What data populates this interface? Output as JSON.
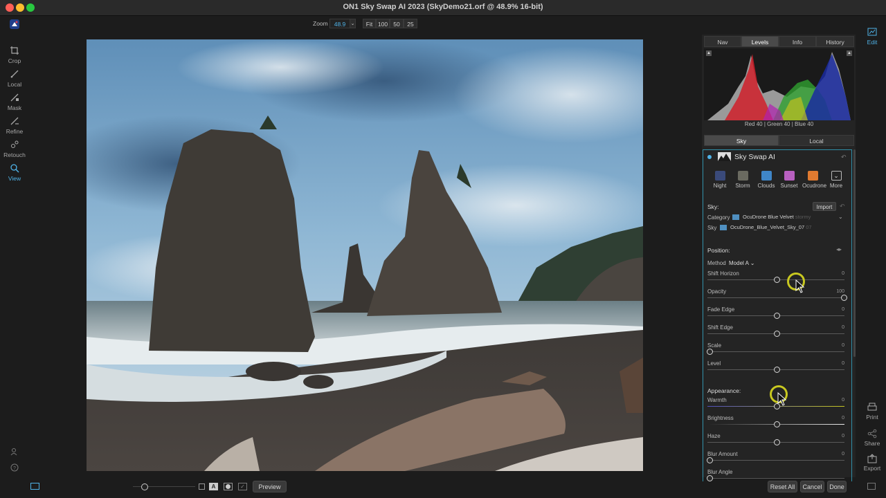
{
  "window": {
    "title": "ON1 Sky Swap AI 2023 (SkyDemo21.orf @ 48.9% 16-bit)"
  },
  "left_tools": [
    {
      "label": "Crop",
      "icon": "crop-icon"
    },
    {
      "label": "Local",
      "icon": "brush-icon"
    },
    {
      "label": "Mask",
      "icon": "mask-brush-icon"
    },
    {
      "label": "Refine",
      "icon": "refine-brush-icon"
    },
    {
      "label": "Retouch",
      "icon": "retouch-icon"
    },
    {
      "label": "View",
      "icon": "view-zoom-icon"
    }
  ],
  "zoom_bar": {
    "label": "Zoom",
    "value": "48.9",
    "presets": [
      "Fit",
      "100",
      "50",
      "25"
    ]
  },
  "panel": {
    "top_tabs": [
      "Nav",
      "Levels",
      "Info",
      "History"
    ],
    "selected_top_tab": "Levels",
    "histogram_readout": "Red  40  | Green  40  | Blue  40",
    "mode_tabs": [
      "Sky",
      "Local"
    ],
    "selected_mode_tab": "Sky",
    "section_title": "Sky Swap AI",
    "sky_presets": [
      {
        "label": "Night",
        "icon": "night-sky-icon",
        "color": "#3a4a7a"
      },
      {
        "label": "Storm",
        "icon": "storm-sky-icon",
        "color": "#6a6a60"
      },
      {
        "label": "Clouds",
        "icon": "clouds-sky-icon",
        "color": "#3f86c8"
      },
      {
        "label": "Sunset",
        "icon": "sunset-sky-icon",
        "color": "#b860c0"
      },
      {
        "label": "Ocudrone",
        "icon": "ocudrone-sky-icon",
        "color": "#e07a30"
      },
      {
        "label": "More",
        "icon": "more-chevron-icon",
        "color": "#2a2a2a"
      }
    ],
    "sky_heading": "Sky:",
    "import_label": "Import",
    "category_label": "Category",
    "category_value": "OcuDrone Blue Velvet",
    "category_ghost": "stormy",
    "sky_label": "Sky",
    "sky_value": "OcuDrone_Blue_Velvet_Sky_07",
    "sky_ghost": "07",
    "position_heading": "Position:",
    "method_label": "Method",
    "method_value": "Model A",
    "position_sliders": [
      {
        "label": "Shift Horizon",
        "value": "0",
        "level": 0.5
      },
      {
        "label": "Opacity",
        "value": "100",
        "level": 1.0
      },
      {
        "label": "Fade Edge",
        "value": "0",
        "level": 0.5
      },
      {
        "label": "Shift Edge",
        "value": "0",
        "level": 0.5
      },
      {
        "label": "Scale",
        "value": "0",
        "level": 0.0
      },
      {
        "label": "Level",
        "value": "0",
        "level": 0.5
      }
    ],
    "appearance_heading": "Appearance:",
    "appearance_sliders": [
      {
        "label": "Warmth",
        "value": "0",
        "level": 0.5
      },
      {
        "label": "Brightness",
        "value": "0",
        "level": 0.5
      },
      {
        "label": "Haze",
        "value": "0",
        "level": 0.5
      },
      {
        "label": "Blur Amount",
        "value": "0",
        "level": 0.0
      },
      {
        "label": "Blur Angle",
        "value": "",
        "level": 0.0
      }
    ]
  },
  "right_rail": [
    {
      "label": "Edit",
      "icon": "edit-icon"
    },
    {
      "label": "Print",
      "icon": "print-icon"
    },
    {
      "label": "Share",
      "icon": "share-icon"
    },
    {
      "label": "Export",
      "icon": "export-icon"
    }
  ],
  "bottom_bar": {
    "preview_label": "Preview",
    "reset_label": "Reset All",
    "cancel_label": "Cancel",
    "done_label": "Done"
  },
  "colors": {
    "accent": "#4fb3e8",
    "close": "#ff5f57",
    "minimize": "#febc2e",
    "zoom": "#28c840"
  }
}
